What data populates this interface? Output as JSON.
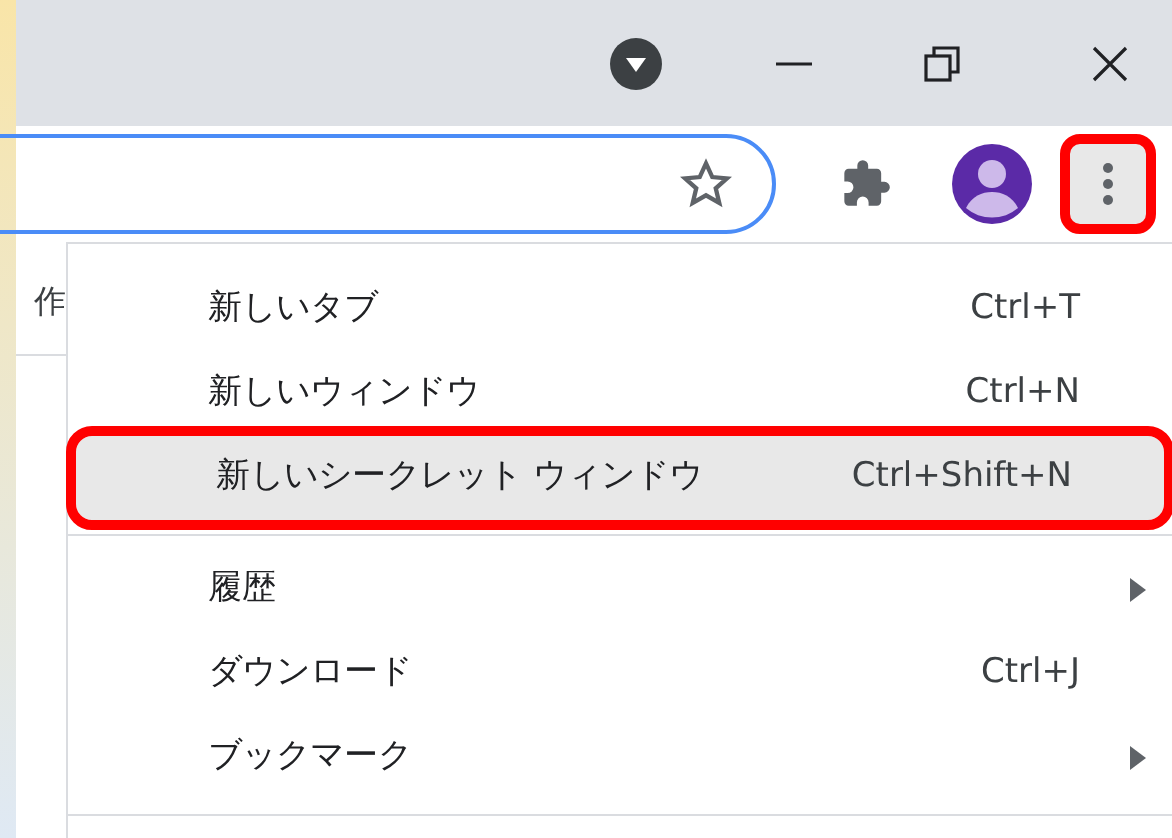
{
  "page_text": "作",
  "toolbar": {
    "menu_button_highlighted": true
  },
  "menu": {
    "items": [
      {
        "kind": "item",
        "label": "新しいタブ",
        "shortcut": "Ctrl+T",
        "selected": false,
        "highlighted": false
      },
      {
        "kind": "item",
        "label": "新しいウィンドウ",
        "shortcut": "Ctrl+N",
        "selected": false,
        "highlighted": false
      },
      {
        "kind": "item",
        "label": "新しいシークレット ウィンドウ",
        "shortcut": "Ctrl+Shift+N",
        "selected": true,
        "highlighted": true
      },
      {
        "kind": "separator"
      },
      {
        "kind": "submenu",
        "label": "履歴",
        "selected": false,
        "highlighted": false
      },
      {
        "kind": "item",
        "label": "ダウンロード",
        "shortcut": "Ctrl+J",
        "selected": false,
        "highlighted": false
      },
      {
        "kind": "submenu",
        "label": "ブックマーク",
        "selected": false,
        "highlighted": false
      },
      {
        "kind": "separator"
      }
    ]
  }
}
